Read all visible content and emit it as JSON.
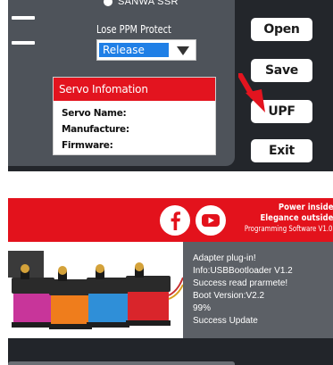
{
  "settings": {
    "sanwa_label": "SANWA SSR",
    "lose_ppm_label": "Lose PPM Protect",
    "lose_ppm_value": "Release"
  },
  "servo_info": {
    "title": "Servo Infomation",
    "name_label": "Servo Name:",
    "manufacture_label": "Manufacture:",
    "firmware_label": "Firmware:"
  },
  "buttons": {
    "open": "Open",
    "save": "Save",
    "upf": "UPF",
    "exit": "Exit"
  },
  "banner": {
    "slogan_line1": "Power inside",
    "slogan_line2": "Elegance outside",
    "slogan_line3": "Programming Software V1.0",
    "social_icons": [
      "facebook-icon",
      "youtube-icon"
    ]
  },
  "log": {
    "lines": [
      "Adapter plug-in!",
      "Info:USBBootloader V1.2",
      "Success read prarmete!",
      "Boot Version:V2.2",
      "99%",
      "Success Update"
    ]
  },
  "colors": {
    "accent_red": "#e3141f",
    "select_blue": "#1f7fe6",
    "panel_dark": "#23262b",
    "panel_grey": "#4e535a"
  }
}
